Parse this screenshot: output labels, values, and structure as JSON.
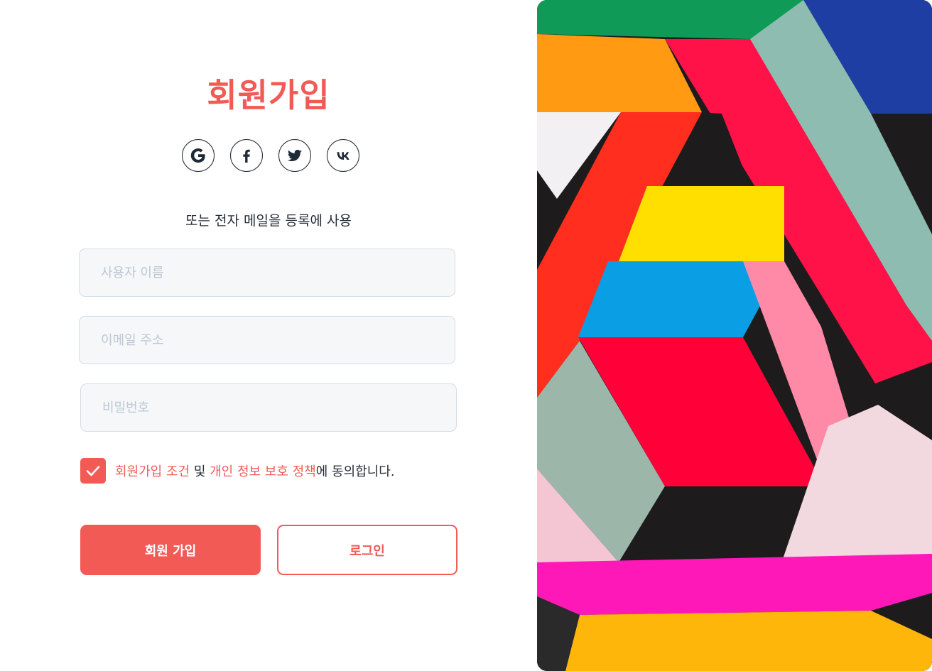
{
  "signup": {
    "title": "회원가입",
    "social_buttons": [
      {
        "icon": "google-icon",
        "label": "G"
      },
      {
        "icon": "facebook-icon",
        "label": "f"
      },
      {
        "icon": "twitter-icon"
      },
      {
        "icon": "vk-icon",
        "label": "VK"
      }
    ],
    "subtitle": "또는 전자 메일을 등록에 사용",
    "fields": {
      "username": {
        "placeholder": "사용자 이름",
        "value": ""
      },
      "email": {
        "placeholder": "이메일 주소",
        "value": ""
      },
      "password": {
        "placeholder": "비밀번호",
        "value": ""
      }
    },
    "agreement": {
      "checked": true,
      "terms_link": "회원가입 조건",
      "and": " 및 ",
      "privacy_link": "개인 정보 보호 정책",
      "suffix": "에 동의합니다."
    },
    "buttons": {
      "signup": "회원 가입",
      "login": "로그인"
    }
  },
  "colors": {
    "accent": "#f25a56",
    "text": "#262e38",
    "field_bg": "#f5f7f9",
    "field_border": "#d3dde6"
  }
}
